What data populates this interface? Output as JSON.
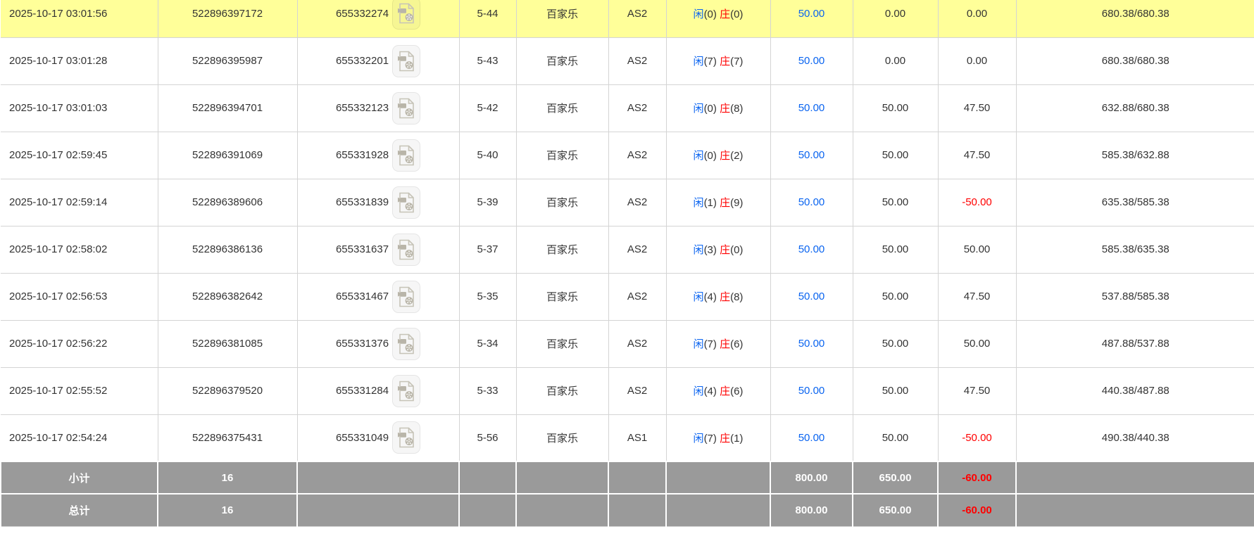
{
  "colors": {
    "highlight_row_bg": "#ffff99",
    "summary_row_bg": "#9a9a9a",
    "player_blue": "#0a64f0",
    "banker_red": "#ff0000",
    "negative_red": "#ff0000",
    "grid_border": "#d4d4d4"
  },
  "icons": {
    "video_replay": "video-file-reel-icon"
  },
  "table": {
    "rows": [
      {
        "highlighted": true,
        "time": "2025-10-17 03:01:56",
        "bet_id": "522896397172",
        "round_id": "655332274",
        "round_no": "5-44",
        "game": "百家乐",
        "table_name": "AS2",
        "player_label": "闲",
        "player_points": "(0)",
        "banker_label": "庄",
        "banker_points": "(0)",
        "bet_amount": "50.00",
        "valid_amount": "0.00",
        "win_loss": "0.00",
        "balance": "680.38/680.38"
      },
      {
        "highlighted": false,
        "time": "2025-10-17 03:01:28",
        "bet_id": "522896395987",
        "round_id": "655332201",
        "round_no": "5-43",
        "game": "百家乐",
        "table_name": "AS2",
        "player_label": "闲",
        "player_points": "(7)",
        "banker_label": "庄",
        "banker_points": "(7)",
        "bet_amount": "50.00",
        "valid_amount": "0.00",
        "win_loss": "0.00",
        "balance": "680.38/680.38"
      },
      {
        "highlighted": false,
        "time": "2025-10-17 03:01:03",
        "bet_id": "522896394701",
        "round_id": "655332123",
        "round_no": "5-42",
        "game": "百家乐",
        "table_name": "AS2",
        "player_label": "闲",
        "player_points": "(0)",
        "banker_label": "庄",
        "banker_points": "(8)",
        "bet_amount": "50.00",
        "valid_amount": "50.00",
        "win_loss": "47.50",
        "balance": "632.88/680.38"
      },
      {
        "highlighted": false,
        "time": "2025-10-17 02:59:45",
        "bet_id": "522896391069",
        "round_id": "655331928",
        "round_no": "5-40",
        "game": "百家乐",
        "table_name": "AS2",
        "player_label": "闲",
        "player_points": "(0)",
        "banker_label": "庄",
        "banker_points": "(2)",
        "bet_amount": "50.00",
        "valid_amount": "50.00",
        "win_loss": "47.50",
        "balance": "585.38/632.88"
      },
      {
        "highlighted": false,
        "time": "2025-10-17 02:59:14",
        "bet_id": "522896389606",
        "round_id": "655331839",
        "round_no": "5-39",
        "game": "百家乐",
        "table_name": "AS2",
        "player_label": "闲",
        "player_points": "(1)",
        "banker_label": "庄",
        "banker_points": "(9)",
        "bet_amount": "50.00",
        "valid_amount": "50.00",
        "win_loss": "-50.00",
        "balance": "635.38/585.38"
      },
      {
        "highlighted": false,
        "time": "2025-10-17 02:58:02",
        "bet_id": "522896386136",
        "round_id": "655331637",
        "round_no": "5-37",
        "game": "百家乐",
        "table_name": "AS2",
        "player_label": "闲",
        "player_points": "(3)",
        "banker_label": "庄",
        "banker_points": "(0)",
        "bet_amount": "50.00",
        "valid_amount": "50.00",
        "win_loss": "50.00",
        "balance": "585.38/635.38"
      },
      {
        "highlighted": false,
        "time": "2025-10-17 02:56:53",
        "bet_id": "522896382642",
        "round_id": "655331467",
        "round_no": "5-35",
        "game": "百家乐",
        "table_name": "AS2",
        "player_label": "闲",
        "player_points": "(4)",
        "banker_label": "庄",
        "banker_points": "(8)",
        "bet_amount": "50.00",
        "valid_amount": "50.00",
        "win_loss": "47.50",
        "balance": "537.88/585.38"
      },
      {
        "highlighted": false,
        "time": "2025-10-17 02:56:22",
        "bet_id": "522896381085",
        "round_id": "655331376",
        "round_no": "5-34",
        "game": "百家乐",
        "table_name": "AS2",
        "player_label": "闲",
        "player_points": "(7)",
        "banker_label": "庄",
        "banker_points": "(6)",
        "bet_amount": "50.00",
        "valid_amount": "50.00",
        "win_loss": "50.00",
        "balance": "487.88/537.88"
      },
      {
        "highlighted": false,
        "time": "2025-10-17 02:55:52",
        "bet_id": "522896379520",
        "round_id": "655331284",
        "round_no": "5-33",
        "game": "百家乐",
        "table_name": "AS2",
        "player_label": "闲",
        "player_points": "(4)",
        "banker_label": "庄",
        "banker_points": "(6)",
        "bet_amount": "50.00",
        "valid_amount": "50.00",
        "win_loss": "47.50",
        "balance": "440.38/487.88"
      },
      {
        "highlighted": false,
        "time": "2025-10-17 02:54:24",
        "bet_id": "522896375431",
        "round_id": "655331049",
        "round_no": "5-56",
        "game": "百家乐",
        "table_name": "AS1",
        "player_label": "闲",
        "player_points": "(7)",
        "banker_label": "庄",
        "banker_points": "(1)",
        "bet_amount": "50.00",
        "valid_amount": "50.00",
        "win_loss": "-50.00",
        "balance": "490.38/440.38"
      }
    ],
    "subtotal": {
      "label": "小计",
      "count": "16",
      "bet_amount": "800.00",
      "valid_amount": "650.00",
      "win_loss": "-60.00"
    },
    "total": {
      "label": "总计",
      "count": "16",
      "bet_amount": "800.00",
      "valid_amount": "650.00",
      "win_loss": "-60.00"
    }
  }
}
